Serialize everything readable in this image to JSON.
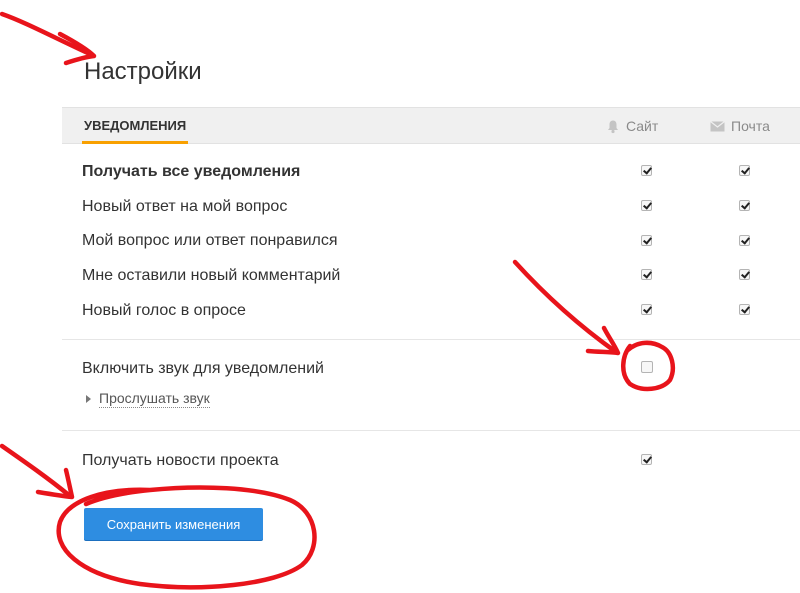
{
  "page": {
    "title": "Настройки"
  },
  "tabs": {
    "notifications": "УВЕДОМЛЕНИЯ"
  },
  "columns": {
    "site": "Сайт",
    "mail": "Почта"
  },
  "rows": [
    {
      "label": "Получать все уведомления",
      "bold": true,
      "site": true,
      "mail": true
    },
    {
      "label": "Новый ответ на мой вопрос",
      "bold": false,
      "site": true,
      "mail": true
    },
    {
      "label": "Мой вопрос или ответ понравился",
      "bold": false,
      "site": true,
      "mail": true
    },
    {
      "label": "Мне оставили новый комментарий",
      "bold": false,
      "site": true,
      "mail": true
    },
    {
      "label": "Новый голос в опросе",
      "bold": false,
      "site": true,
      "mail": true
    }
  ],
  "sound": {
    "label": "Включить звук для уведомлений",
    "checked": false,
    "play_label": "Прослушать звук"
  },
  "news": {
    "label": "Получать новости проекта",
    "checked": true
  },
  "actions": {
    "save_label": "Сохранить изменения"
  },
  "colors": {
    "accent_tab": "#f8a000",
    "button": "#2e8de1",
    "annotation": "#e8141b"
  },
  "icons": {
    "site": "bell-icon",
    "mail": "envelope-icon"
  }
}
